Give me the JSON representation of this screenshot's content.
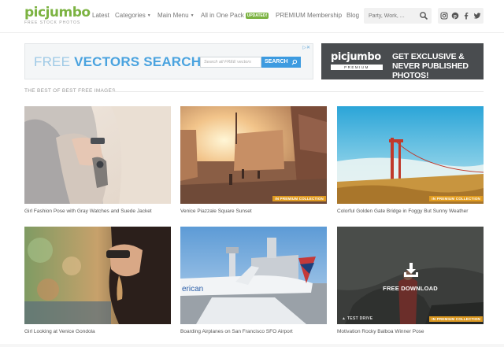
{
  "header": {
    "logo": "picjumbo",
    "tagline": "FREE STOCK PHOTOS",
    "nav": [
      {
        "label": "Latest"
      },
      {
        "label": "Categories",
        "caret": "▼"
      },
      {
        "label": "Main Menu",
        "caret": "▼"
      },
      {
        "label": "All in One Pack",
        "badge": "UPDATED!"
      },
      {
        "label": "PREMIUM Membership"
      },
      {
        "label": "Blog"
      }
    ],
    "search_placeholder": "Party, Work, ...",
    "social_icons": [
      "instagram-icon",
      "pinterest-icon",
      "facebook-icon",
      "twitter-icon"
    ]
  },
  "ads": {
    "vectors": {
      "text_light": "FREE ",
      "text_bold": "VECTORS SEARCH",
      "input_placeholder": "Search all FREE vectors",
      "button": "SEARCH",
      "close": "▷✕"
    },
    "premium": {
      "logo": "picjumbo",
      "logo_bar": "PREMIUM",
      "message": "GET EXCLUSIVE & NEVER PUBLISHED PHOTOS!"
    }
  },
  "section": {
    "title": "THE BEST OF BEST FREE IMAGES"
  },
  "photos": [
    {
      "caption": "Girl Fashion Pose with Gray Watches and Suede Jacket",
      "tag": ""
    },
    {
      "caption": "Venice Piazzale Square Sunset",
      "tag": "IN PREMIUM COLLECTION"
    },
    {
      "caption": "Colorful Golden Gate Bridge in Foggy But Sunny Weather",
      "tag": "IN PREMIUM COLLECTION"
    },
    {
      "caption": "Girl Looking at Venice Gondola",
      "tag": ""
    },
    {
      "caption": "Boarding Airplanes on San Francisco SFO Airport",
      "tag": ""
    },
    {
      "caption": "Motivation Rocky Balboa Winner Pose",
      "tag": "IN PREMIUM COLLECTION",
      "overlay": "FREE DOWNLOAD",
      "test_drive": "TEST DRIVE"
    }
  ],
  "colors": {
    "brand": "#7cb342",
    "accent_blue": "#3d9be0",
    "premium_tag": "#e7a01e"
  }
}
